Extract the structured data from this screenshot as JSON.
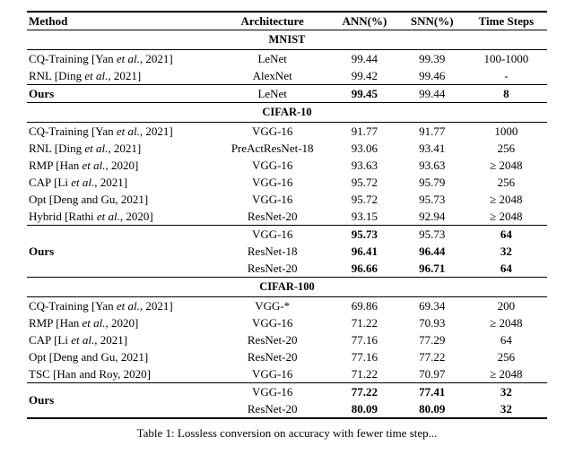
{
  "headers": {
    "method": "Method",
    "arch": "Architecture",
    "ann": "ANN(%)",
    "snn": "SNN(%)",
    "steps": "Time Steps"
  },
  "sections": {
    "mnist": "MNIST",
    "cifar10": "CIFAR-10",
    "cifar100": "CIFAR-100"
  },
  "rows": {
    "m_cq": {
      "name": "CQ-Training ",
      "ref": "[Yan ",
      "refital": "et al.",
      "refend": ", 2021]",
      "arch": "LeNet",
      "ann": "99.44",
      "snn": "99.39",
      "steps": "100-1000"
    },
    "m_rnl": {
      "name": "RNL ",
      "ref": "[Ding ",
      "refital": "et al.",
      "refend": ", 2021]",
      "arch": "AlexNet",
      "ann": "99.42",
      "snn": "99.46",
      "steps": "-"
    },
    "m_ours": {
      "name": "Ours",
      "arch": "LeNet",
      "ann": "99.45",
      "snn": "99.44",
      "steps": "8"
    },
    "c10_cq": {
      "name": "CQ-Training ",
      "ref": "[Yan ",
      "refital": "et al.",
      "refend": ", 2021]",
      "arch": "VGG-16",
      "ann": "91.77",
      "snn": "91.77",
      "steps": "1000"
    },
    "c10_rnl": {
      "name": "RNL ",
      "ref": "[Ding ",
      "refital": "et al.",
      "refend": ", 2021]",
      "arch": "PreActResNet-18",
      "ann": "93.06",
      "snn": "93.41",
      "steps": "256"
    },
    "c10_rmp": {
      "name": "RMP ",
      "ref": "[Han ",
      "refital": "et al.",
      "refend": ", 2020]",
      "arch": "VGG-16",
      "ann": "93.63",
      "snn": "93.63",
      "steps": "≥ 2048"
    },
    "c10_cap": {
      "name": "CAP ",
      "ref": "[Li ",
      "refital": "et al.",
      "refend": ", 2021]",
      "arch": "VGG-16",
      "ann": "95.72",
      "snn": "95.79",
      "steps": "256"
    },
    "c10_opt": {
      "name": "Opt ",
      "ref": "[Deng and Gu, 2021]",
      "refital": "",
      "refend": "",
      "arch": "VGG-16",
      "ann": "95.72",
      "snn": "95.73",
      "steps": "≥ 2048"
    },
    "c10_hyb": {
      "name": "Hybrid ",
      "ref": "[Rathi ",
      "refital": "et al.",
      "refend": ", 2020]",
      "arch": "ResNet-20",
      "ann": "93.15",
      "snn": "92.94",
      "steps": "≥ 2048"
    },
    "c10_o1": {
      "arch": "VGG-16",
      "ann": "95.73",
      "snn": "95.73",
      "steps": "64"
    },
    "c10_o2": {
      "arch": "ResNet-18",
      "ann": "96.41",
      "snn": "96.44",
      "steps": "32"
    },
    "c10_o3": {
      "arch": "ResNet-20",
      "ann": "96.66",
      "snn": "96.71",
      "steps": "64"
    },
    "c10_ours_name": "Ours",
    "c100_cq": {
      "name": "CQ-Training ",
      "ref": "[Yan ",
      "refital": "et al.",
      "refend": ", 2021]",
      "arch": "VGG-*",
      "ann": "69.86",
      "snn": "69.34",
      "steps": "200"
    },
    "c100_rmp": {
      "name": "RMP ",
      "ref": "[Han ",
      "refital": "et al.",
      "refend": ", 2020]",
      "arch": "VGG-16",
      "ann": "71.22",
      "snn": "70.93",
      "steps": "≥ 2048"
    },
    "c100_cap": {
      "name": "CAP ",
      "ref": "[Li ",
      "refital": "et al.",
      "refend": ", 2021]",
      "arch": "ResNet-20",
      "ann": "77.16",
      "snn": "77.29",
      "steps": "64"
    },
    "c100_opt": {
      "name": "Opt ",
      "ref": "[Deng and Gu, 2021]",
      "refital": "",
      "refend": "",
      "arch": "ResNet-20",
      "ann": "77.16",
      "snn": "77.22",
      "steps": "256"
    },
    "c100_tsc": {
      "name": "TSC ",
      "ref": "[Han and Roy, 2020]",
      "refital": "",
      "refend": "",
      "arch": "VGG-16",
      "ann": "71.22",
      "snn": "70.97",
      "steps": "≥ 2048"
    },
    "c100_o1": {
      "arch": "VGG-16",
      "ann": "77.22",
      "snn": "77.41",
      "steps": "32"
    },
    "c100_o2": {
      "arch": "ResNet-20",
      "ann": "80.09",
      "snn": "80.09",
      "steps": "32"
    },
    "c100_ours_name": "Ours"
  },
  "caption": "Table 1: Lossless conversion on accuracy with fewer time step..."
}
